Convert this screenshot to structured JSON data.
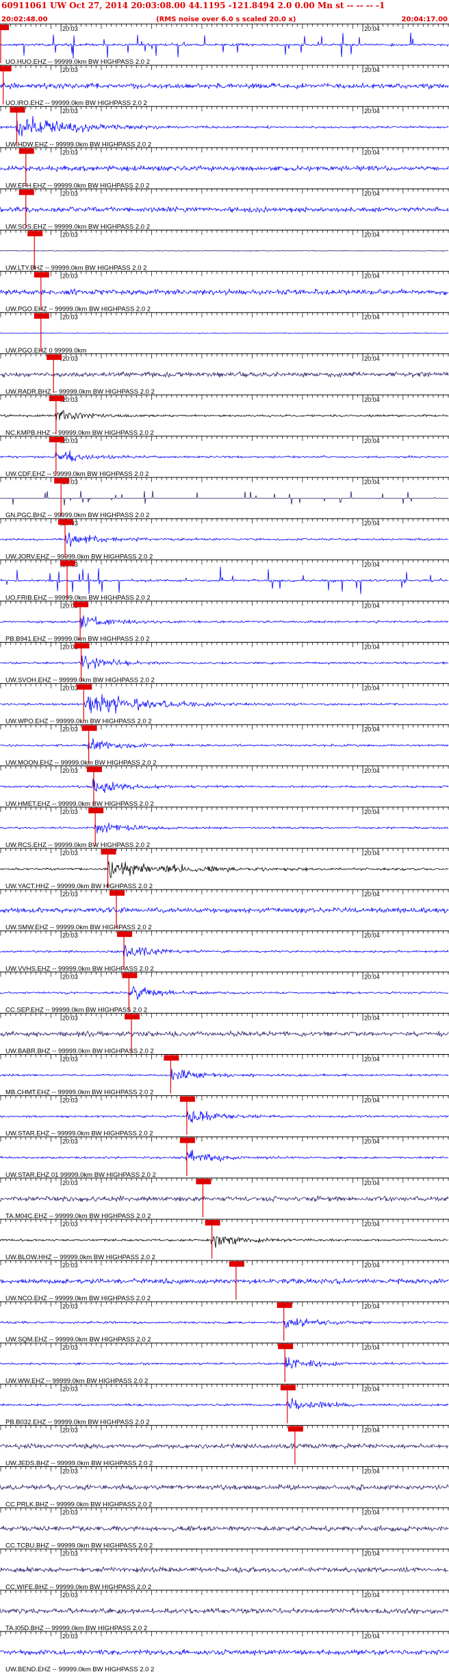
{
  "header": {
    "title": "60911061 UW Oct 27, 2014 20:03:08.00   44.1195 -121.8494  2.0 0.00 Mn st -- -- --  -1",
    "start_time": "20:02:48.00",
    "subtitle": "(RMS noise over 6.0 s scaled 20.0 x)",
    "end_time": "20:04:17.00"
  },
  "chart_data": {
    "type": "line",
    "title": "60911061 UW Oct 27, 2014 20:03:08.00   44.1195 -121.8494  2.0 0.00 Mn st -- -- --  -1",
    "time_window": [
      "20:02:48.00",
      "20:04:17.00"
    ],
    "minute_labels": [
      "20:03",
      "20:04"
    ],
    "minute_seconds": [
      12,
      72
    ],
    "window_seconds": 89,
    "colors": {
      "black": "#000000",
      "blue": "#0000ff",
      "navy": "#2a1a66",
      "pick": "#e00000"
    },
    "traces": [
      {
        "label": "UO.HUO.EHZ -- 99999.0km BW  HIGHPASS  2.0  2",
        "pick": 0.0,
        "color": "blue",
        "style": "spikes"
      },
      {
        "label": "UO.IRO.EHZ -- 99999.0km BW  HIGHPASS  2.0  2",
        "pick": 0.5,
        "color": "blue",
        "style": "noise"
      },
      {
        "label": "UW.HDW.EHZ -- 99999.0km BW  HIGHPASS  2.0  2",
        "pick": 3.2,
        "color": "blue",
        "style": "burst"
      },
      {
        "label": "UW.EPH.EHZ -- 99999.0km BW  HIGHPASS  2.0  2",
        "pick": 5.0,
        "color": "blue",
        "style": "noise"
      },
      {
        "label": "UW.SOS.EHZ -- 99999.0km BW  HIGHPASS  2.0  2",
        "pick": 5.0,
        "color": "blue",
        "style": "noise"
      },
      {
        "label": "UW.LTY.BHZ -- 99999.0km BW  HIGHPASS  2.0  2",
        "pick": 6.7,
        "color": "navy",
        "style": "quiet"
      },
      {
        "label": "UW.PGO.EHZ -- 99999.0km BW  HIGHPASS  2.0  2",
        "pick": 8.0,
        "color": "blue",
        "style": "noise"
      },
      {
        "label": "UW.PGO.EHZ 0 99999.0km",
        "pick": 8.0,
        "color": "blue",
        "style": "quiet"
      },
      {
        "label": "UW.RADR.BHZ -- 99999.0km BW  HIGHPASS  2.0  2",
        "pick": 10.5,
        "color": "navy",
        "style": "noise"
      },
      {
        "label": "NC.KMPB.HHZ -- 99999.0km BW  HIGHPASS  2.0  2",
        "pick": 11.0,
        "color": "black",
        "style": "event"
      },
      {
        "label": "UW.CDF.EHZ -- 99999.0km BW  HIGHPASS  2.0  2",
        "pick": 11.0,
        "color": "blue",
        "style": "event"
      },
      {
        "label": "GN.PGC.BHZ -- 99999.0km BW  HIGHPASS  2.0  2",
        "pick": 12.0,
        "color": "navy",
        "style": "dots"
      },
      {
        "label": "UW.JORV.EHZ -- 99999.0km BW  HIGHPASS  2.0  2",
        "pick": 12.8,
        "color": "blue",
        "style": "event"
      },
      {
        "label": "UO.FRIB.EHZ -- 99999.0km BW  HIGHPASS  2.0  2",
        "pick": 13.2,
        "color": "blue",
        "style": "spikes"
      },
      {
        "label": "PB.B941.EHZ -- 99999.0km BW  HIGHPASS  2.0  2",
        "pick": 15.8,
        "color": "blue",
        "style": "event"
      },
      {
        "label": "UW.SVOH.EHZ -- 99999.0km BW  HIGHPASS  2.0  2",
        "pick": 16.0,
        "color": "blue",
        "style": "event"
      },
      {
        "label": "UW.WPO.EHZ -- 99999.0km BW  HIGHPASS  2.0  2",
        "pick": 16.5,
        "color": "blue",
        "style": "burst"
      },
      {
        "label": "UW.MOON.EHZ -- 99999.0km BW  HIGHPASS  2.0  2",
        "pick": 17.5,
        "color": "blue",
        "style": "event"
      },
      {
        "label": "UW.HMET.EHZ -- 99999.0km BW  HIGHPASS  2.0  2",
        "pick": 18.5,
        "color": "blue",
        "style": "event"
      },
      {
        "label": "UW.RCS.EHZ -- 99999.0km BW  HIGHPASS  2.0  2",
        "pick": 18.8,
        "color": "blue",
        "style": "event"
      },
      {
        "label": "UW.YACT.HHZ -- 99999.0km BW  HIGHPASS  2.0  2",
        "pick": 21.3,
        "color": "black",
        "style": "burst"
      },
      {
        "label": "UW.SMW.EHZ -- 99999.0km BW  HIGHPASS  2.0  2",
        "pick": 23.0,
        "color": "blue",
        "style": "noise"
      },
      {
        "label": "UW.VVHS.EHZ -- 99999.0km BW  HIGHPASS  2.0  2",
        "pick": 24.5,
        "color": "blue",
        "style": "event"
      },
      {
        "label": "CC.SEP.EHZ -- 99999.0km BW  HIGHPASS  2.0  2",
        "pick": 25.5,
        "color": "blue",
        "style": "event"
      },
      {
        "label": "UW.BABR.BHZ -- 99999.0km BW  HIGHPASS  2.0  2",
        "pick": 26.0,
        "color": "navy",
        "style": "noise"
      },
      {
        "label": "MB.CHMT.EHZ -- 99999.0km BW  HIGHPASS  2.0  2",
        "pick": 33.8,
        "color": "blue",
        "style": "event"
      },
      {
        "label": "UW.STAR.EHZ -- 99999.0km BW  HIGHPASS  2.0  2",
        "pick": 37.0,
        "color": "blue",
        "style": "event"
      },
      {
        "label": "UW.STAR.EHZ 01 99999.0km BW  HIGHPASS  2.0  2",
        "pick": 37.0,
        "color": "blue",
        "style": "event"
      },
      {
        "label": "TA.M04C.EHZ -- 99999.0km BW  HIGHPASS  2.0  2",
        "pick": 40.2,
        "color": "navy",
        "style": "noise"
      },
      {
        "label": "UW.BLOW.HHZ -- 99999.0km BW  HIGHPASS  2.0  2",
        "pick": 42.0,
        "color": "black",
        "style": "event"
      },
      {
        "label": "UW.NCO.EHZ -- 99999.0km BW  HIGHPASS  2.0  2",
        "pick": 46.8,
        "color": "blue",
        "style": "noise"
      },
      {
        "label": "UW.SQM.EHZ -- 99999.0km BW  HIGHPASS  2.0  2",
        "pick": 56.3,
        "color": "blue",
        "style": "event"
      },
      {
        "label": "UW.WW.EHZ -- 99999.0km BW  HIGHPASS  2.0  2",
        "pick": 56.5,
        "color": "blue",
        "style": "event"
      },
      {
        "label": "PB.B032.EHZ -- 99999.0km BW  HIGHPASS  2.0  2",
        "pick": 57.0,
        "color": "blue",
        "style": "event"
      },
      {
        "label": "UW.JEDS.BHZ -- 99999.0km BW  HIGHPASS  2.0  2",
        "pick": 58.5,
        "color": "navy",
        "style": "noise"
      },
      {
        "label": "CC.PRLK.BHZ -- 99999.0km BW  HIGHPASS  2.0  2",
        "pick": null,
        "color": "navy",
        "style": "noise"
      },
      {
        "label": "CC.TCBU.BHZ -- 99999.0km BW  HIGHPASS  2.0  2",
        "pick": null,
        "color": "navy",
        "style": "noise"
      },
      {
        "label": "CC.WIFE.BHZ -- 99999.0km BW  HIGHPASS  2.0  2",
        "pick": null,
        "color": "navy",
        "style": "noise"
      },
      {
        "label": "TA.I05D.BHZ -- 99999.0km BW  HIGHPASS  2.0  2",
        "pick": null,
        "color": "navy",
        "style": "noise"
      },
      {
        "label": "UW.BEND.EHZ -- 99999.0km BW  HIGHPASS  2.0  2",
        "pick": null,
        "color": "blue",
        "style": "noise"
      }
    ]
  }
}
